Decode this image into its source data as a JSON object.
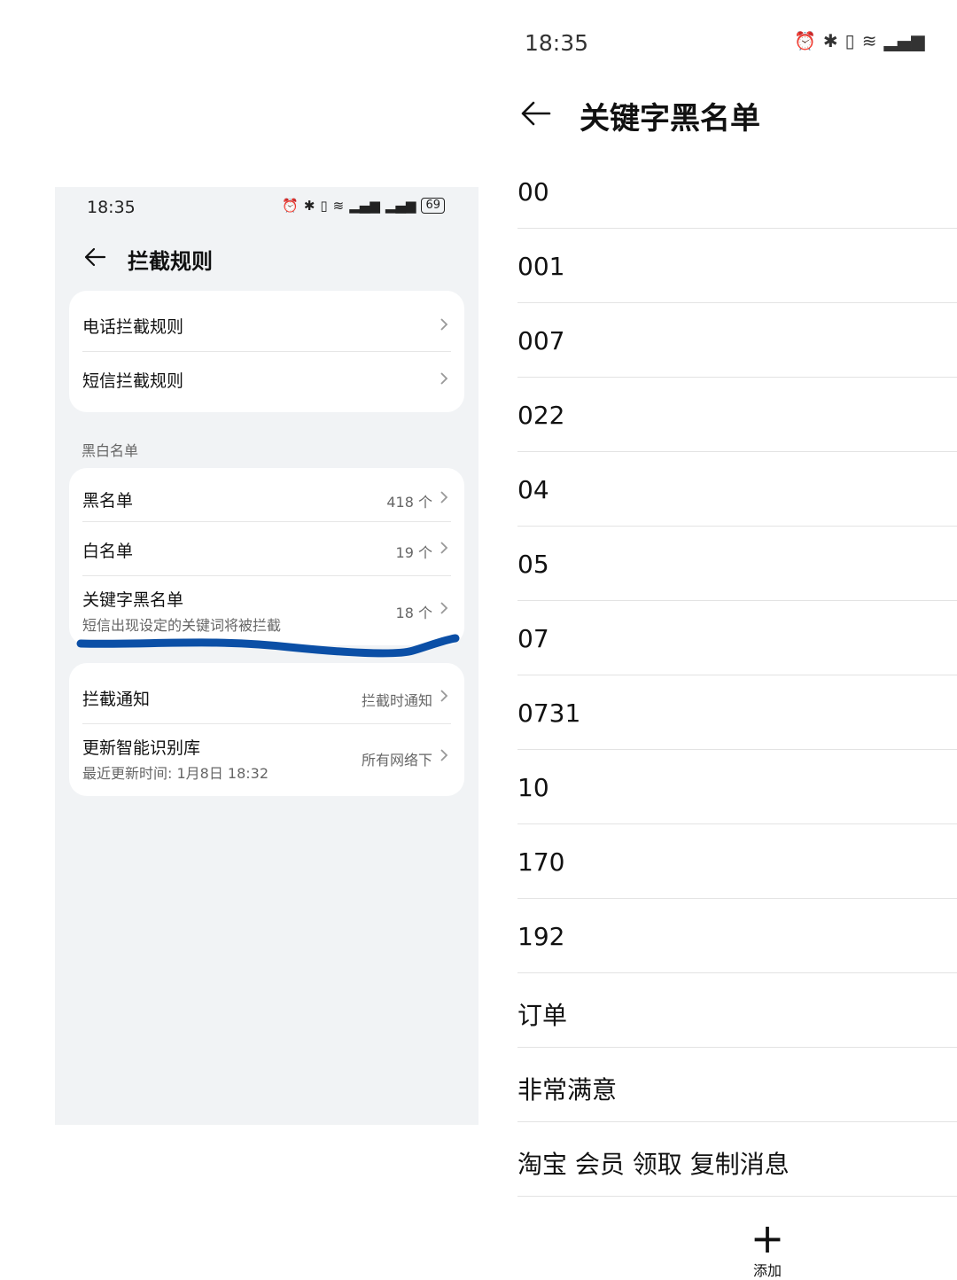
{
  "left": {
    "status_time": "18:35",
    "battery": "69",
    "title": "拦截规则",
    "rules": [
      {
        "label": "电话拦截规则"
      },
      {
        "label": "短信拦截规则"
      }
    ],
    "section_blackwhite": "黑白名单",
    "lists": [
      {
        "label": "黑名单",
        "value": "418 个"
      },
      {
        "label": "白名单",
        "value": "19 个"
      },
      {
        "label": "关键字黑名单",
        "sub": "短信出现设定的关键词将被拦截",
        "value": "18 个"
      }
    ],
    "notify": {
      "label": "拦截通知",
      "value": "拦截时通知"
    },
    "update": {
      "label": "更新智能识别库",
      "sub": "最近更新时间: 1月8日 18:32",
      "value": "所有网络下"
    }
  },
  "right": {
    "status_time": "18:35",
    "title": "关键字黑名单",
    "keywords": [
      "00",
      "001",
      "007",
      "022",
      "04",
      "05",
      "07",
      "0731",
      "10",
      "170",
      "192",
      "订单",
      "非常满意",
      "淘宝 会员 领取 复制消息"
    ],
    "add_label": "添加"
  },
  "colors": {
    "pen_highlight": "#0b4fa6",
    "page_bg_left": "#f1f3f5"
  }
}
